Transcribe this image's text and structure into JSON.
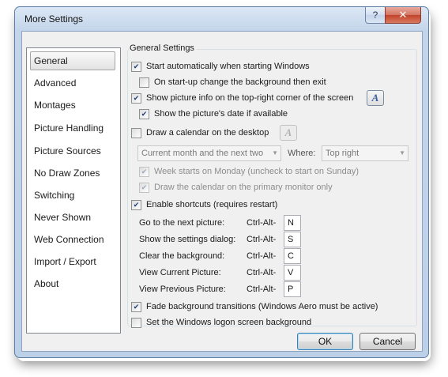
{
  "window": {
    "title": "More Settings",
    "help_glyph": "?",
    "close_glyph": "✕"
  },
  "sidebar": {
    "items": [
      {
        "label": "General",
        "selected": true
      },
      {
        "label": "Advanced"
      },
      {
        "label": "Montages"
      },
      {
        "label": "Picture Handling"
      },
      {
        "label": "Picture Sources"
      },
      {
        "label": "No Draw Zones"
      },
      {
        "label": "Switching"
      },
      {
        "label": "Never Shown"
      },
      {
        "label": "Web Connection"
      },
      {
        "label": "Import / Export"
      },
      {
        "label": "About"
      }
    ]
  },
  "general": {
    "group_title": "General Settings",
    "start_auto": {
      "label": "Start automatically when starting Windows",
      "checked": true
    },
    "startup_bg": {
      "label": "On start-up change the background then exit",
      "checked": false
    },
    "show_info": {
      "label": "Show picture info on the top-right corner of the screen",
      "checked": true
    },
    "show_date": {
      "label": "Show the picture's date if available",
      "checked": true
    },
    "draw_calendar": {
      "label": "Draw a calendar on the desktop",
      "checked": false
    },
    "font_glyph": "A",
    "calendar_range": {
      "value": "Current month and the next two"
    },
    "where_label": "Where:",
    "calendar_where": {
      "value": "Top right"
    },
    "week_monday": {
      "label": "Week starts on Monday (uncheck to start on Sunday)",
      "checked": true
    },
    "primary_only": {
      "label": "Draw the calendar on the primary monitor only",
      "checked": true
    },
    "enable_shortcuts": {
      "label": "Enable shortcuts (requires restart)",
      "checked": true
    },
    "shortcut_prefix": "Ctrl-Alt-",
    "shortcuts": [
      {
        "label": "Go to the next picture:",
        "key": "N"
      },
      {
        "label": "Show the settings dialog:",
        "key": "S"
      },
      {
        "label": "Clear the background:",
        "key": "C"
      },
      {
        "label": "View Current Picture:",
        "key": "V"
      },
      {
        "label": "View Previous Picture:",
        "key": "P"
      }
    ],
    "fade": {
      "label": "Fade background transitions (Windows Aero must be active)",
      "checked": true
    },
    "logon_bg": {
      "label": "Set the Windows logon screen background",
      "checked": false
    }
  },
  "footer": {
    "ok_label": "OK",
    "cancel_label": "Cancel"
  }
}
